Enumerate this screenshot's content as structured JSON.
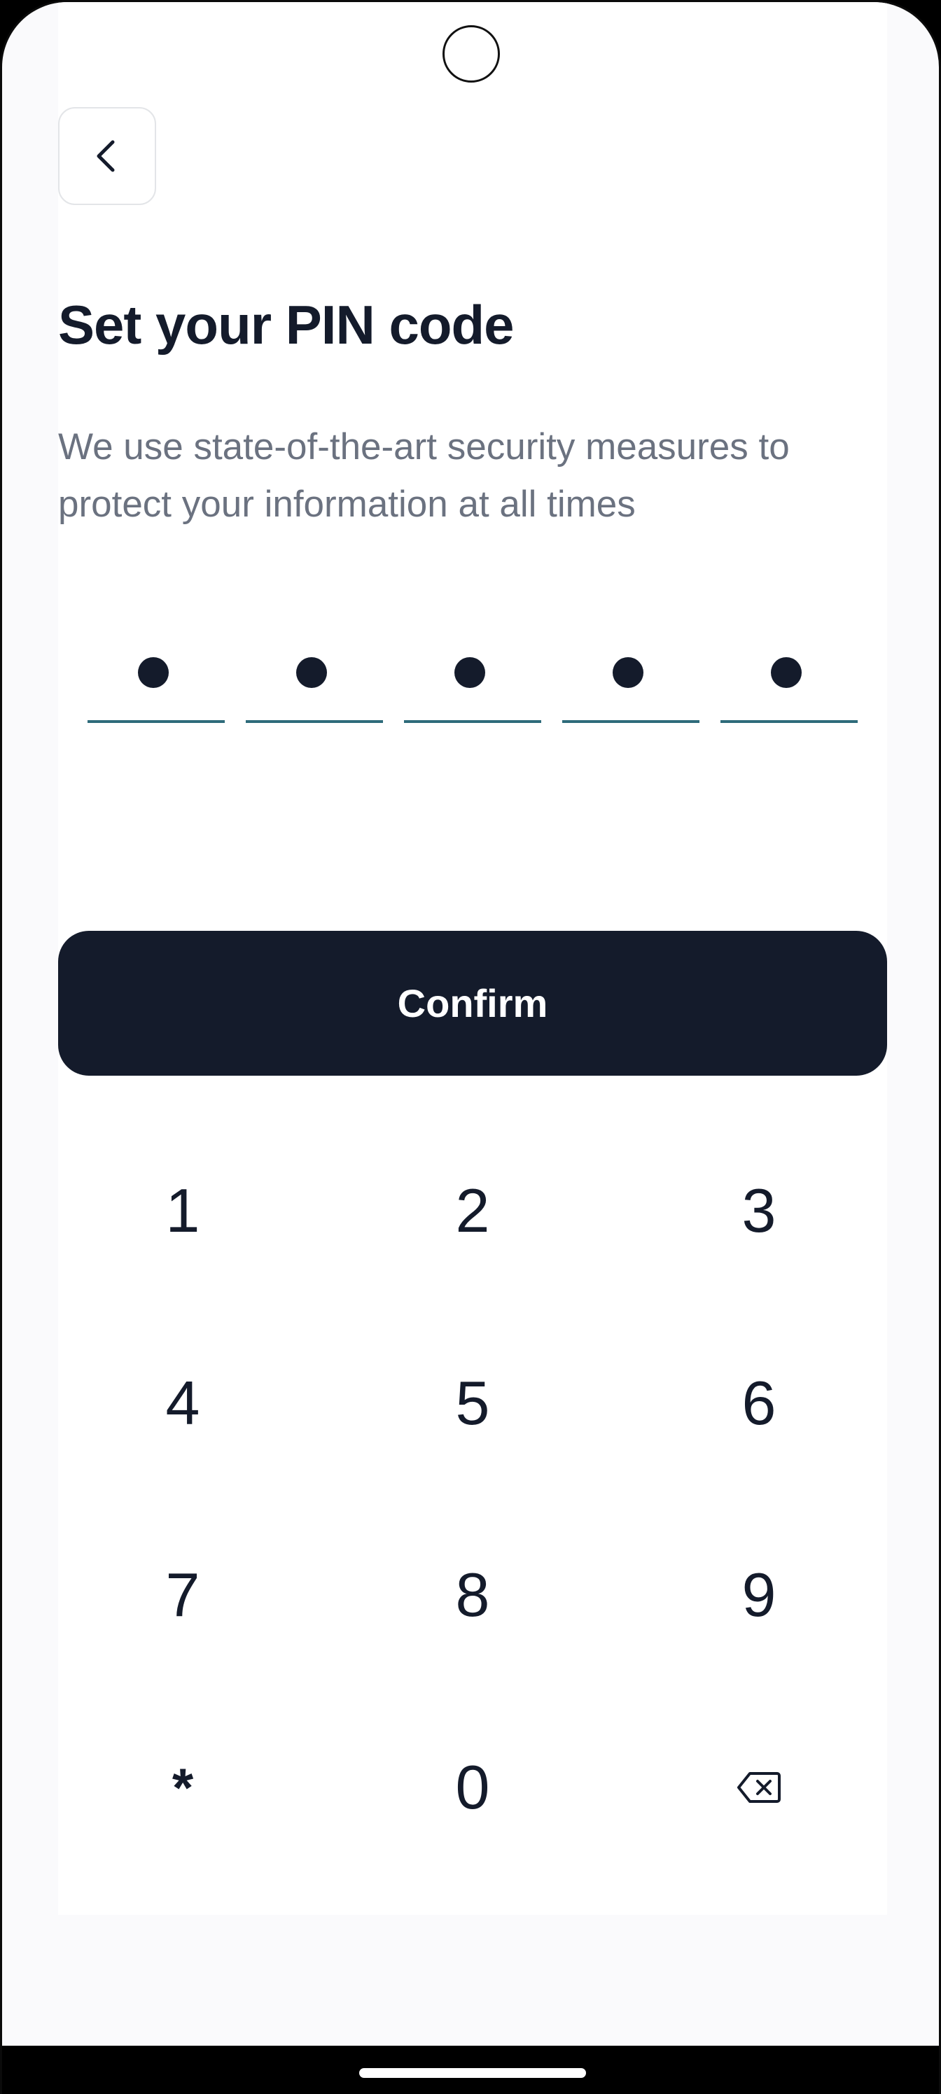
{
  "header": {
    "back_icon": "chevron-left-icon"
  },
  "title": "Set your PIN code",
  "subtitle": "We use state-of-the-art security measures to protect your information at all times",
  "pin": {
    "length": 5,
    "filled": 5
  },
  "confirm_label": "Confirm",
  "keypad": {
    "keys": [
      "1",
      "2",
      "3",
      "4",
      "5",
      "6",
      "7",
      "8",
      "9",
      "*",
      "0"
    ],
    "backspace_icon": "backspace-icon"
  },
  "colors": {
    "primary": "#141B2B",
    "underline": "#2E6B7A",
    "subtitle": "#6B7280",
    "background": "#FAFAFC"
  }
}
